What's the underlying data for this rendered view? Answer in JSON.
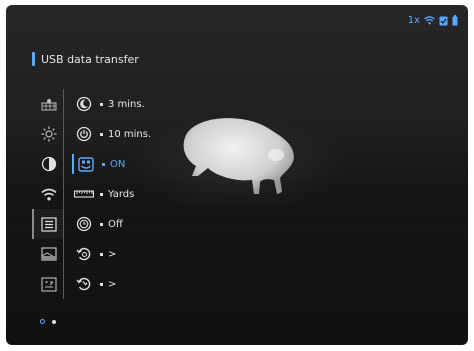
{
  "status": {
    "zoom": "1x",
    "icons": [
      "wifi-icon",
      "battery-check-icon",
      "battery-icon"
    ]
  },
  "header": {
    "title": "USB data transfer"
  },
  "categories": [
    {
      "name": "brightness-grid-icon",
      "active": false
    },
    {
      "name": "sun-icon",
      "active": false
    },
    {
      "name": "contrast-icon",
      "active": false
    },
    {
      "name": "wifi-icon",
      "active": false
    },
    {
      "name": "list-icon",
      "active": true
    },
    {
      "name": "image-icon",
      "active": false
    },
    {
      "name": "grid-icon",
      "active": false
    }
  ],
  "items": [
    {
      "icon": "moon-icon",
      "value": "3 mins."
    },
    {
      "icon": "power-timer-icon",
      "value": "10 mins."
    },
    {
      "icon": "usb-transfer-icon",
      "value": "ON",
      "selected": true
    },
    {
      "icon": "ruler-icon",
      "value": "Yards"
    },
    {
      "icon": "clock-icon",
      "value": "Off"
    },
    {
      "icon": "reset-icon",
      "value": ">"
    },
    {
      "icon": "info-rotate-icon",
      "value": ">"
    }
  ],
  "pager": {
    "pages": 2,
    "current": 1
  },
  "colors": {
    "accent": "#5aa9ff",
    "text": "#e8e8e8"
  }
}
